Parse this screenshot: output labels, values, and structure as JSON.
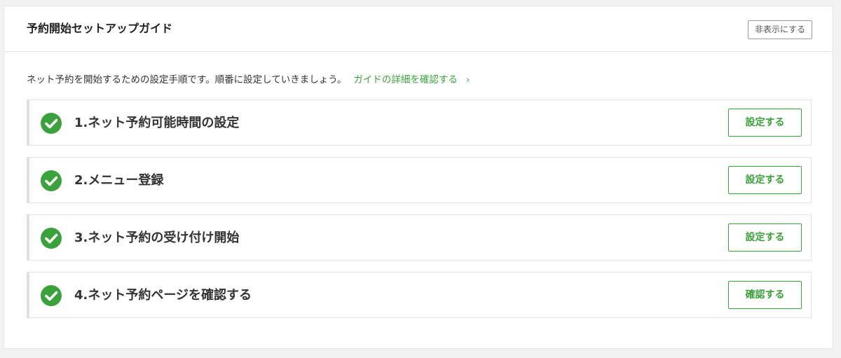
{
  "header": {
    "title": "予約開始セットアップガイド",
    "hide_label": "非表示にする"
  },
  "intro": {
    "text": "ネット予約を開始するための設定手順です。順番に設定していきましょう。",
    "link_label": "ガイドの詳細を確認する",
    "link_chevron": "›"
  },
  "colors": {
    "accent_green": "#3aa23a",
    "check_green": "#3aa23a"
  },
  "steps": [
    {
      "title": "1.ネット予約可能時間の設定",
      "button_label": "設定する",
      "completed": true,
      "icon": "check-circle-icon"
    },
    {
      "title": "2.メニュー登録",
      "button_label": "設定する",
      "completed": true,
      "icon": "check-circle-icon"
    },
    {
      "title": "3.ネット予約の受け付け開始",
      "button_label": "設定する",
      "completed": true,
      "icon": "check-circle-icon"
    },
    {
      "title": "4.ネット予約ページを確認する",
      "button_label": "確認する",
      "completed": true,
      "icon": "check-circle-icon"
    }
  ]
}
